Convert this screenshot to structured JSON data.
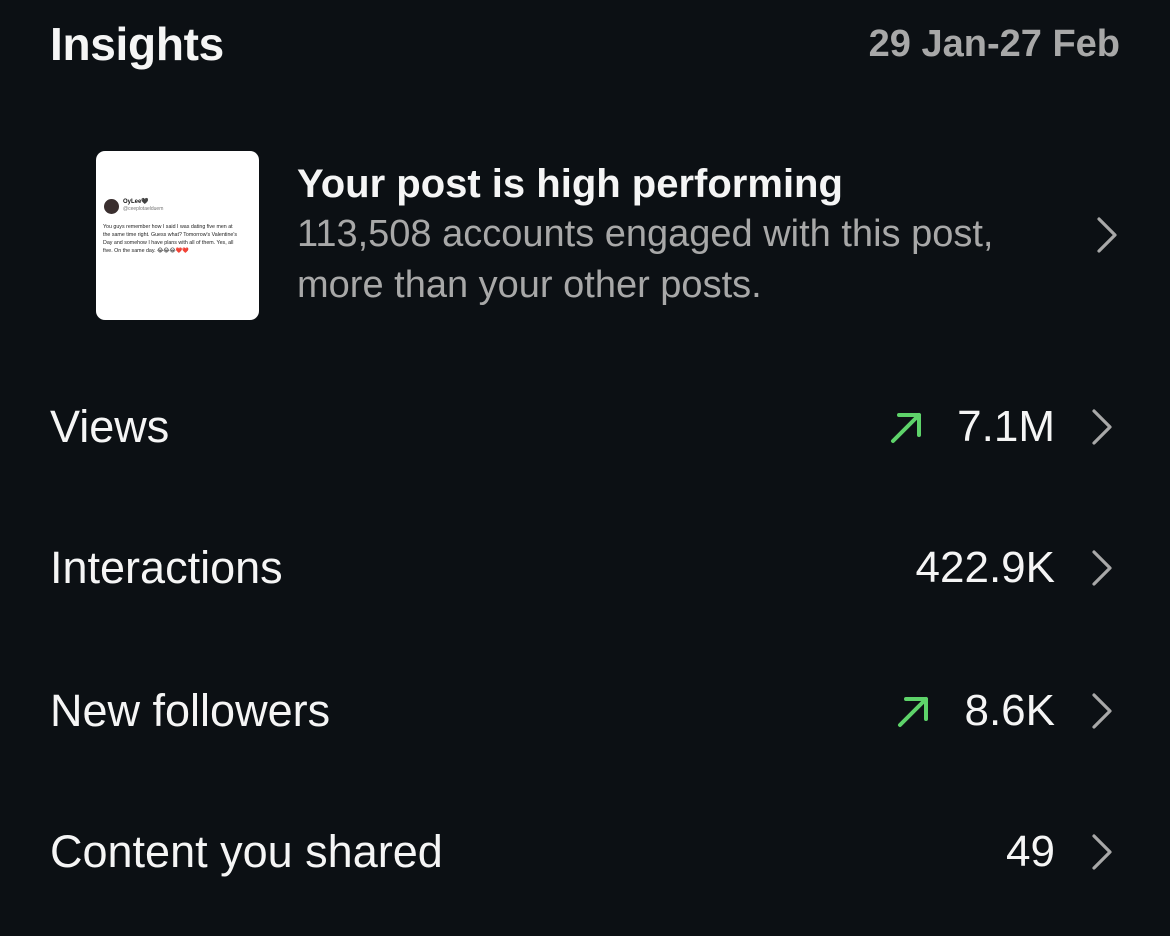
{
  "header": {
    "title": "Insights",
    "date_range": "29 Jan-27 Feb"
  },
  "highlight": {
    "title": "Your post is high performing",
    "description": "113,508 accounts engaged with this post, more than your other posts.",
    "thumbnail": {
      "author_name": "OyLee🖤",
      "author_handle": "@ceeplotaelduem",
      "text": "You guys remember how I said I was dating five men at the same time right. Guess what? Tomorrow's Valentine's Day and somehow I have plans with all of them. Yes, all five. On the same day. 😂😂😂❤️❤️"
    }
  },
  "metrics": [
    {
      "label": "Views",
      "value": "7.1M",
      "trend": "up"
    },
    {
      "label": "Interactions",
      "value": "422.9K",
      "trend": "none"
    },
    {
      "label": "New followers",
      "value": "8.6K",
      "trend": "up"
    },
    {
      "label": "Content you shared",
      "value": "49",
      "trend": "none"
    }
  ],
  "colors": {
    "background": "#0c1014",
    "primary_text": "#f5f5f5",
    "secondary_text": "#a8a8a8",
    "trend_up": "#5ed36a",
    "chevron": "#a8a8a8"
  },
  "icons": {
    "chevron": "chevron-right-icon",
    "trend_up": "trend-up-arrow-icon"
  }
}
